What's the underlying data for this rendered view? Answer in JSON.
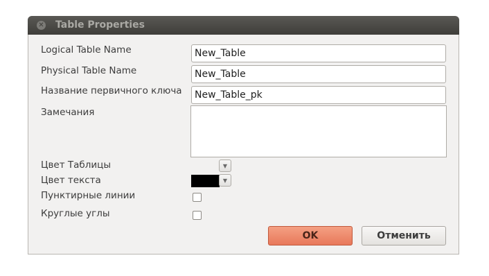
{
  "window": {
    "title": "Table Properties",
    "close_icon": "close-icon"
  },
  "form": {
    "logical_name": {
      "label": "Logical Table Name",
      "value": "New_Table"
    },
    "physical_name": {
      "label": "Physical Table Name",
      "value": "New_Table"
    },
    "pk_name": {
      "label": "Название первичного ключа",
      "value": "New_Table_pk"
    },
    "notes": {
      "label": "Замечания",
      "value": ""
    },
    "table_color": {
      "label": "Цвет Таблицы",
      "color": "#f2f1f0"
    },
    "text_color": {
      "label": "Цвет текста",
      "color": "#000000"
    },
    "dashed_lines": {
      "label": "Пунктирные линии",
      "checked": false
    },
    "rounded_corners": {
      "label": "Круглые углы",
      "checked": false
    }
  },
  "buttons": {
    "ok": "OK",
    "cancel": "Отменить"
  },
  "colors": {
    "titlebar": "#3f3e3a",
    "dialog_bg": "#f2f1f0",
    "accent": "#e8785a"
  }
}
